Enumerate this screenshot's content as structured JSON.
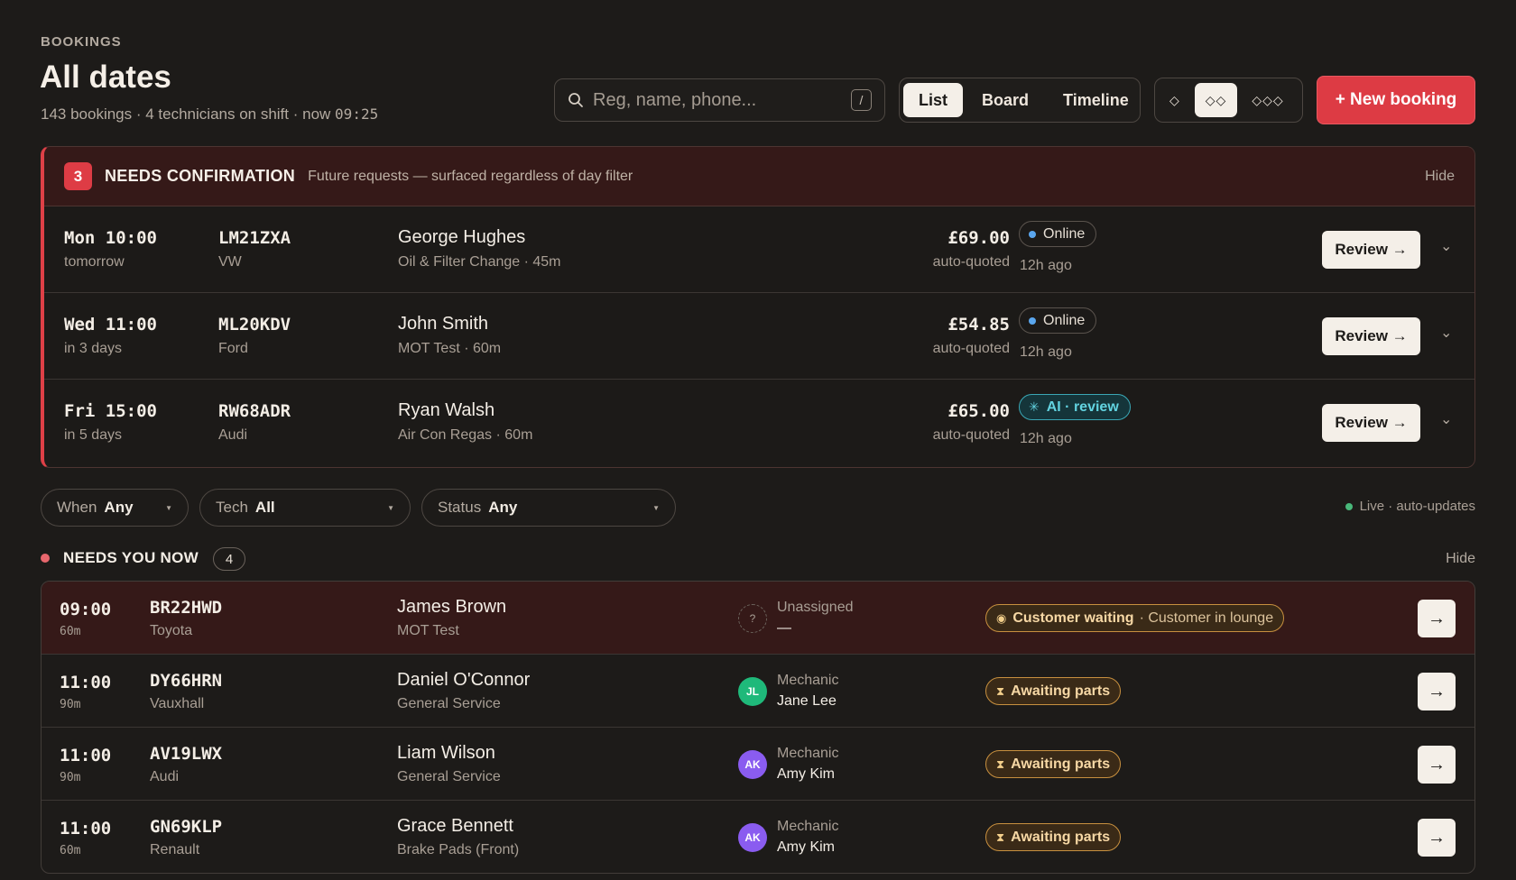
{
  "header": {
    "eyebrow": "BOOKINGS",
    "title": "All dates",
    "subtitle": "143 bookings · 4 technicians on shift · now",
    "now_time": "09:25"
  },
  "search": {
    "placeholder": "Reg, name, phone...",
    "shortcut": "/"
  },
  "view_switch": {
    "options": [
      "List",
      "Board",
      "Timeline"
    ],
    "active": "List"
  },
  "density_switch": {
    "options": [
      "◇",
      "◇◇",
      "◇◇◇"
    ],
    "active": "◇◇"
  },
  "new_booking_label": "+ New booking",
  "needs_confirmation": {
    "count": "3",
    "title": "NEEDS CONFIRMATION",
    "subtitle": "Future requests — surfaced regardless of day filter",
    "hide_label": "Hide",
    "review_label": "Review →",
    "rows": [
      {
        "when": "Mon 10:00",
        "relative": "tomorrow",
        "reg": "LM21ZXA",
        "make": "VW",
        "name": "George Hughes",
        "service": "Oil & Filter Change · 45m",
        "price": "£69.00",
        "price_note": "auto-quoted",
        "source": "Online",
        "ago": "12h ago"
      },
      {
        "when": "Wed 11:00",
        "relative": "in 3 days",
        "reg": "ML20KDV",
        "make": "Ford",
        "name": "John Smith",
        "service": "MOT Test · 60m",
        "price": "£54.85",
        "price_note": "auto-quoted",
        "source": "Online",
        "ago": "12h ago"
      },
      {
        "when": "Fri 15:00",
        "relative": "in 5 days",
        "reg": "RW68ADR",
        "make": "Audi",
        "name": "Ryan Walsh",
        "service": "Air Con Regas · 60m",
        "price": "£65.00",
        "price_note": "auto-quoted",
        "source": "AI · review",
        "ago": "12h ago"
      }
    ]
  },
  "filters": {
    "when": {
      "label": "When",
      "value": "Any"
    },
    "tech": {
      "label": "Tech",
      "value": "All"
    },
    "status": {
      "label": "Status",
      "value": "Any"
    },
    "live_text": "Live · auto-updates"
  },
  "needs_you_now": {
    "title": "NEEDS YOU NOW",
    "count": "4",
    "hide_label": "Hide",
    "rows": [
      {
        "time": "09:00",
        "duration": "60m",
        "reg": "BR22HWD",
        "make": "Toyota",
        "name": "James Brown",
        "service": "MOT Test",
        "avatar": "?",
        "role": "Unassigned",
        "tech": "—",
        "status": "Customer waiting",
        "status_note": "· Customer in lounge"
      },
      {
        "time": "11:00",
        "duration": "90m",
        "reg": "DY66HRN",
        "make": "Vauxhall",
        "name": "Daniel O'Connor",
        "service": "General Service",
        "avatar": "JL",
        "role": "Mechanic",
        "tech": "Jane Lee",
        "status": "Awaiting parts",
        "status_note": ""
      },
      {
        "time": "11:00",
        "duration": "90m",
        "reg": "AV19LWX",
        "make": "Audi",
        "name": "Liam Wilson",
        "service": "General Service",
        "avatar": "AK",
        "role": "Mechanic",
        "tech": "Amy Kim",
        "status": "Awaiting parts",
        "status_note": ""
      },
      {
        "time": "11:00",
        "duration": "60m",
        "reg": "GN69KLP",
        "make": "Renault",
        "name": "Grace Bennett",
        "service": "Brake Pads (Front)",
        "avatar": "AK",
        "role": "Mechanic",
        "tech": "Amy Kim",
        "status": "Awaiting parts",
        "status_note": ""
      }
    ]
  },
  "colors": {
    "accent": "#dd3b44",
    "online": "#5aa6ee",
    "ai": "#62d3e0",
    "jane_lee": "#1fb97a",
    "amy_kim": "#8a5cf0",
    "warning": "#c8903f"
  },
  "icons": {
    "search": "search-icon",
    "spark": "sparkle-icon",
    "hourglass": "hourglass-icon",
    "waiting": "dot-icon",
    "arrow": "arrow-right-icon",
    "chevron": "chevron-down-icon"
  }
}
